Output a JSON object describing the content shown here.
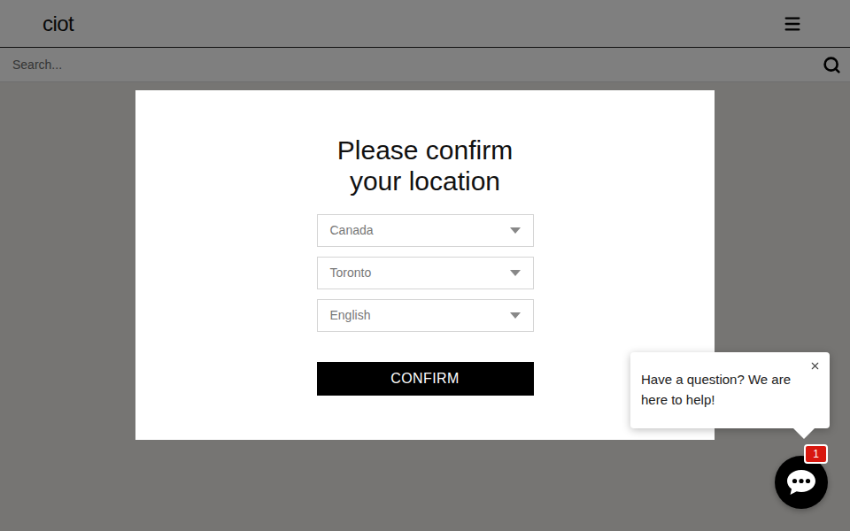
{
  "header": {
    "logo": "ciot"
  },
  "search": {
    "placeholder": "Search..."
  },
  "modal": {
    "title": "Please confirm your location",
    "fields": [
      {
        "value": "Canada"
      },
      {
        "value": "Toronto"
      },
      {
        "value": "English"
      }
    ],
    "button": "CONFIRM"
  },
  "chat": {
    "prompt": "Have a question? We are here to help!",
    "unread": "1"
  }
}
